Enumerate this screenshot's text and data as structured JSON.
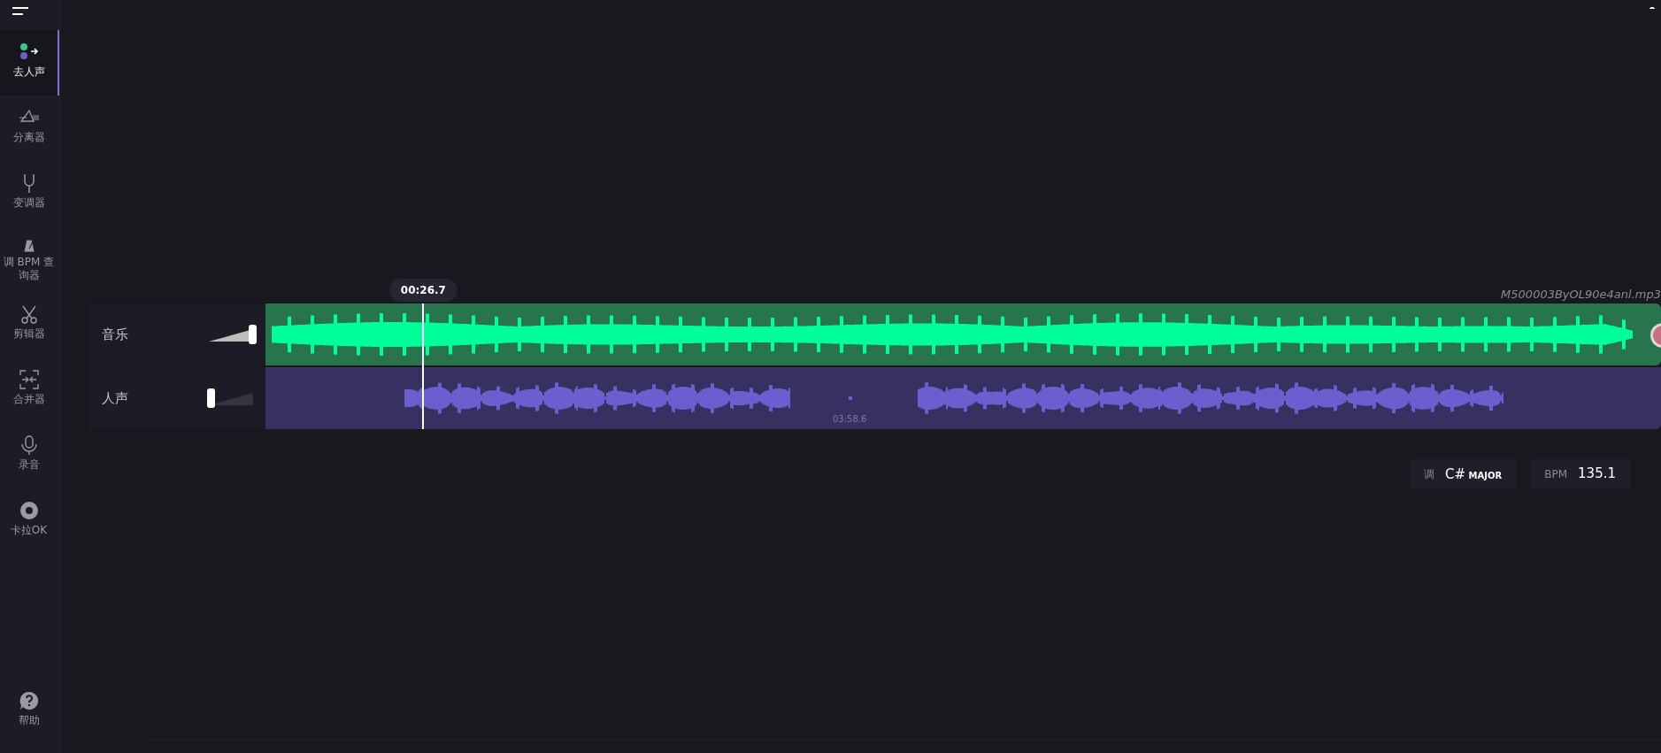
{
  "sidebar": {
    "items": [
      {
        "label": "去人声",
        "selected": true
      },
      {
        "label": "分离器",
        "selected": false
      },
      {
        "label": "变调器",
        "selected": false
      },
      {
        "label": "调 BPM 查询器",
        "selected": false
      },
      {
        "label": "剪辑器",
        "selected": false
      },
      {
        "label": "合并器",
        "selected": false
      },
      {
        "label": "录音",
        "selected": false
      },
      {
        "label": "卡拉OK",
        "selected": false
      }
    ],
    "help": {
      "label": "帮助"
    }
  },
  "playhead": {
    "time": "00:26.7",
    "level": 0.112
  },
  "file_name": "M500003ByOL90e4anl.mp3",
  "tracks": [
    {
      "label": "音乐",
      "kind": "music",
      "level": 1
    },
    {
      "label": "人声",
      "kind": "vocal",
      "level": 0
    }
  ],
  "duration_marker": "03:58.6",
  "key": {
    "label": "调",
    "value": "C#",
    "mode": "MAJOR"
  },
  "bpm": {
    "label": "BPM",
    "value": "135.1"
  }
}
